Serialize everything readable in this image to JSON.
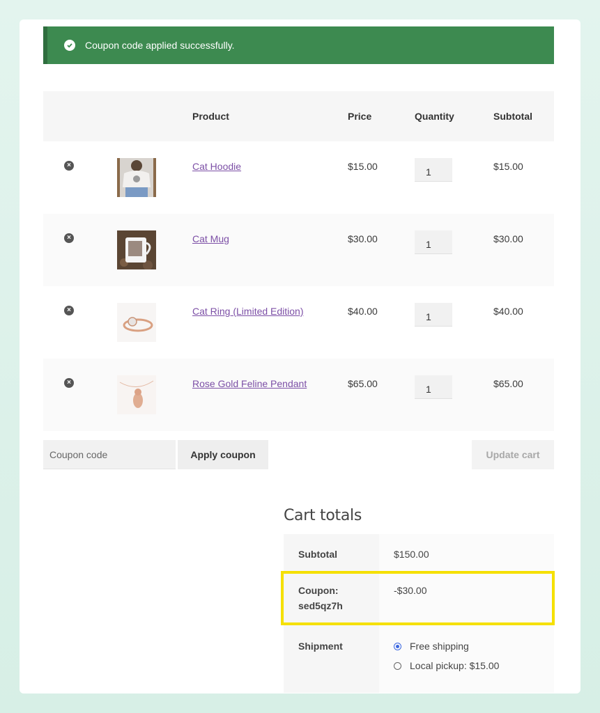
{
  "notice": {
    "text": "Coupon code applied successfully.",
    "icon": "check-circle-icon",
    "color": "#3d8a50"
  },
  "table": {
    "headers": {
      "product": "Product",
      "price": "Price",
      "quantity": "Quantity",
      "subtotal": "Subtotal"
    },
    "items": [
      {
        "name": "Cat Hoodie",
        "price": "$15.00",
        "qty": "1",
        "subtotal": "$15.00"
      },
      {
        "name": "Cat Mug",
        "price": "$30.00",
        "qty": "1",
        "subtotal": "$30.00"
      },
      {
        "name": "Cat Ring (Limited Edition)",
        "price": "$40.00",
        "qty": "1",
        "subtotal": "$40.00"
      },
      {
        "name": "Rose Gold Feline Pendant",
        "price": "$65.00",
        "qty": "1",
        "subtotal": "$65.00"
      }
    ]
  },
  "actions": {
    "coupon_placeholder": "Coupon code",
    "apply_label": "Apply coupon",
    "update_label": "Update cart"
  },
  "totals": {
    "title": "Cart totals",
    "subtotal_label": "Subtotal",
    "subtotal_value": "$150.00",
    "coupon_label": "Coupon: sed5qz7h",
    "coupon_value": "-$30.00",
    "shipment_label": "Shipment",
    "shipping_options": [
      "Free shipping",
      "Local pickup: $15.00"
    ],
    "selected_shipping": "Free shipping"
  },
  "colors": {
    "link": "#7c4fa6",
    "highlight": "#f5e000",
    "radio": "#3a66e0"
  }
}
